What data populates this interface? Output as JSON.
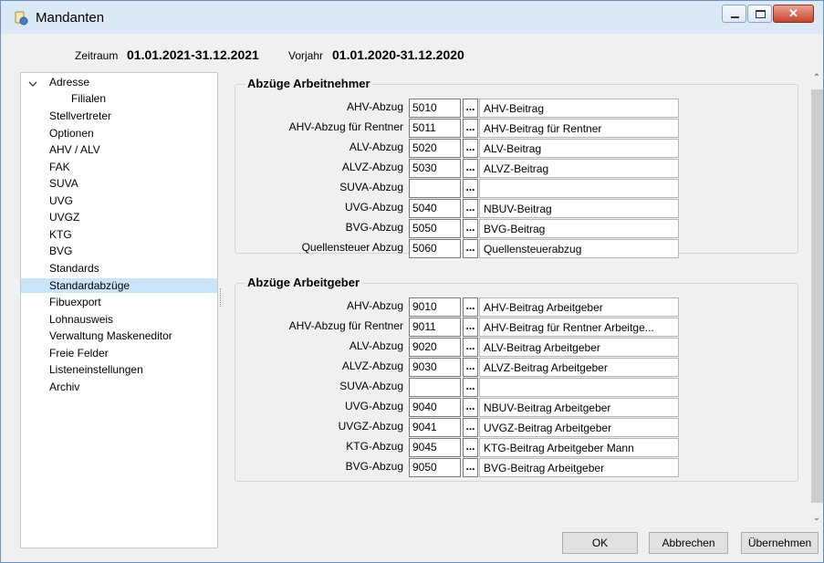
{
  "window": {
    "title": "Mandanten"
  },
  "period": {
    "zeitraum_label": "Zeitraum",
    "zeitraum_value": "01.01.2021-31.12.2021",
    "vorjahr_label": "Vorjahr",
    "vorjahr_value": "01.01.2020-31.12.2020"
  },
  "sidebar": {
    "items": [
      {
        "label": "Adresse",
        "expanded": true
      },
      {
        "label": "Filialen",
        "child": true
      },
      {
        "label": "Stellvertreter"
      },
      {
        "label": "Optionen"
      },
      {
        "label": "AHV / ALV"
      },
      {
        "label": "FAK"
      },
      {
        "label": "SUVA"
      },
      {
        "label": "UVG"
      },
      {
        "label": "UVGZ"
      },
      {
        "label": "KTG"
      },
      {
        "label": "BVG"
      },
      {
        "label": "Standards"
      },
      {
        "label": "Standardabzüge",
        "selected": true
      },
      {
        "label": "Fibuexport"
      },
      {
        "label": "Lohnausweis"
      },
      {
        "label": "Verwaltung Maskeneditor"
      },
      {
        "label": "Freie Felder"
      },
      {
        "label": "Listeneinstellungen"
      },
      {
        "label": "Archiv"
      }
    ]
  },
  "arbeitnehmer": {
    "title": "Abzüge Arbeitnehmer",
    "rows": [
      {
        "label": "AHV-Abzug",
        "code": "5010",
        "desc": "AHV-Beitrag"
      },
      {
        "label": "AHV-Abzug für Rentner",
        "code": "5011",
        "desc": "AHV-Beitrag für Rentner"
      },
      {
        "label": "ALV-Abzug",
        "code": "5020",
        "desc": "ALV-Beitrag"
      },
      {
        "label": "ALVZ-Abzug",
        "code": "5030",
        "desc": "ALVZ-Beitrag"
      },
      {
        "label": "SUVA-Abzug",
        "code": "",
        "desc": ""
      },
      {
        "label": "UVG-Abzug",
        "code": "5040",
        "desc": "NBUV-Beitrag"
      },
      {
        "label": "BVG-Abzug",
        "code": "5050",
        "desc": "BVG-Beitrag"
      },
      {
        "label": "Quellensteuer Abzug",
        "code": "5060",
        "desc": "Quellensteuerabzug"
      }
    ]
  },
  "arbeitgeber": {
    "title": "Abzüge Arbeitgeber",
    "rows": [
      {
        "label": "AHV-Abzug",
        "code": "9010",
        "desc": "AHV-Beitrag Arbeitgeber"
      },
      {
        "label": "AHV-Abzug für Rentner",
        "code": "9011",
        "desc": "AHV-Beitrag für Rentner Arbeitge..."
      },
      {
        "label": "ALV-Abzug",
        "code": "9020",
        "desc": "ALV-Beitrag Arbeitgeber"
      },
      {
        "label": "ALVZ-Abzug",
        "code": "9030",
        "desc": "ALVZ-Beitrag Arbeitgeber"
      },
      {
        "label": "SUVA-Abzug",
        "code": "",
        "desc": ""
      },
      {
        "label": "UVG-Abzug",
        "code": "9040",
        "desc": "NBUV-Beitrag Arbeitgeber"
      },
      {
        "label": "UVGZ-Abzug",
        "code": "9041",
        "desc": "UVGZ-Beitrag Arbeitgeber"
      },
      {
        "label": "KTG-Abzug",
        "code": "9045",
        "desc": "KTG-Beitrag Arbeitgeber Mann"
      },
      {
        "label": "BVG-Abzug",
        "code": "9050",
        "desc": "BVG-Beitrag Arbeitgeber"
      }
    ]
  },
  "lookup_button_label": "...",
  "buttons": {
    "ok": "OK",
    "cancel": "Abbrechen",
    "apply": "Übernehmen"
  },
  "colors": {
    "selection": "#cce4f7",
    "titlebar": "#dbe8f6",
    "close_button": "#c7432b"
  }
}
